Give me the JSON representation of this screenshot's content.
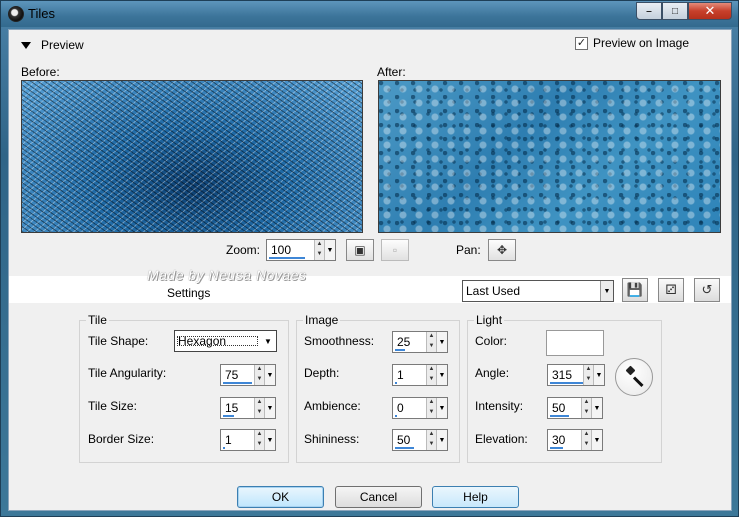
{
  "window": {
    "title": "Tiles"
  },
  "preview": {
    "toggle_label": "Preview",
    "preview_on_image_label": "Preview on Image",
    "preview_on_image_checked": true,
    "before_label": "Before:",
    "after_label": "After:",
    "zoom_label": "Zoom:",
    "zoom_value": "100",
    "pan_label": "Pan:"
  },
  "watermark": "Made by  Neusa Novaes",
  "settings": {
    "label": "Settings",
    "preset_value": "Last Used"
  },
  "tile": {
    "title": "Tile",
    "shape_label": "Tile Shape:",
    "shape_value": "Hexagon",
    "angularity_label": "Tile Angularity:",
    "angularity_value": "75",
    "angularity_level": 0.75,
    "size_label": "Tile Size:",
    "size_value": "15",
    "size_level": 0.3,
    "border_label": "Border Size:",
    "border_value": "1",
    "border_level": 0.05
  },
  "image": {
    "title": "Image",
    "smoothness_label": "Smoothness:",
    "smoothness_value": "25",
    "smoothness_level": 0.25,
    "depth_label": "Depth:",
    "depth_value": "1",
    "depth_level": 0.05,
    "ambience_label": "Ambience:",
    "ambience_value": "0",
    "ambience_level": 0.0,
    "shininess_label": "Shininess:",
    "shininess_value": "50",
    "shininess_level": 0.5
  },
  "light": {
    "title": "Light",
    "color_label": "Color:",
    "color_value": "#ffffff",
    "angle_label": "Angle:",
    "angle_value": "315",
    "angle_level": 0.875,
    "intensity_label": "Intensity:",
    "intensity_value": "50",
    "intensity_level": 0.5,
    "elevation_label": "Elevation:",
    "elevation_value": "30",
    "elevation_level": 0.33
  },
  "buttons": {
    "ok": "OK",
    "cancel": "Cancel",
    "help": "Help"
  }
}
